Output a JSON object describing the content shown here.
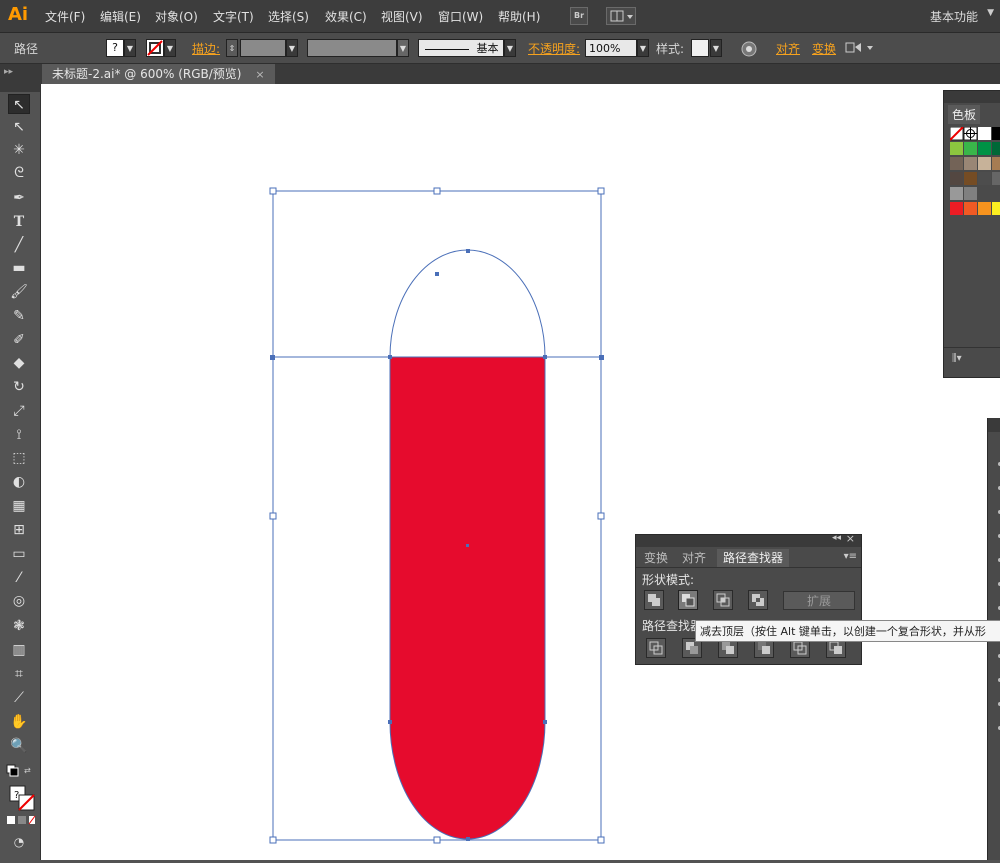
{
  "app": {
    "logo": "Ai",
    "menus": [
      "文件(F)",
      "编辑(E)",
      "对象(O)",
      "文字(T)",
      "选择(S)",
      "效果(C)",
      "视图(V)",
      "窗口(W)",
      "帮助(H)"
    ],
    "bridge_label": "Br",
    "workspace": "基本功能"
  },
  "control_bar": {
    "object_type": "路径",
    "fill_value": "?",
    "stroke_label": "描边:",
    "brush_label": "基本",
    "opacity_label": "不透明度:",
    "opacity_value": "100%",
    "style_label": "样式:",
    "align_label": "对齐",
    "transform_label": "变换"
  },
  "document_tab": {
    "title": "未标题-2.ai* @ 600% (RGB/预览)",
    "close": "×"
  },
  "tools": [
    "selection-tool",
    "direct-selection-tool",
    "magic-wand-tool",
    "lasso-tool",
    "pen-tool",
    "type-tool",
    "line-tool",
    "rectangle-tool",
    "paintbrush-tool",
    "pencil-tool",
    "blob-brush-tool",
    "eraser-tool",
    "rotate-tool",
    "scale-tool",
    "width-tool",
    "free-transform-tool",
    "shape-builder-tool",
    "perspective-grid-tool",
    "mesh-tool",
    "gradient-tool",
    "eyedropper-tool",
    "blend-tool",
    "symbol-sprayer-tool",
    "column-graph-tool",
    "artboard-tool",
    "slice-tool",
    "hand-tool",
    "zoom-tool"
  ],
  "swatches_panel": {
    "title": "色板",
    "colors": [
      "#ffffff",
      "#000000",
      "#8cc63f",
      "#39b54a",
      "#009245",
      "#006837",
      "#736357",
      "#998675",
      "#c7b299",
      "#a67c52",
      "#534741",
      "#754c24",
      "#4d4d4d",
      "#666666",
      "#999999",
      "#808080",
      "#ed1c24",
      "#f15a24",
      "#f7931e",
      "#fcee21"
    ]
  },
  "pathfinder_panel": {
    "tabs": [
      "变换",
      "对齐",
      "路径查找器"
    ],
    "shape_modes_label": "形状模式:",
    "pathfinders_label": "路径查找器:",
    "expand_label": "扩展"
  },
  "tooltip": {
    "text": "减去顶层（按住 Alt 键单击，以创建一个复合形状，并从形"
  },
  "colors": {
    "shape_fill": "#e60b2d",
    "selection": "#4a6fb8",
    "accent": "#f6a21e"
  }
}
